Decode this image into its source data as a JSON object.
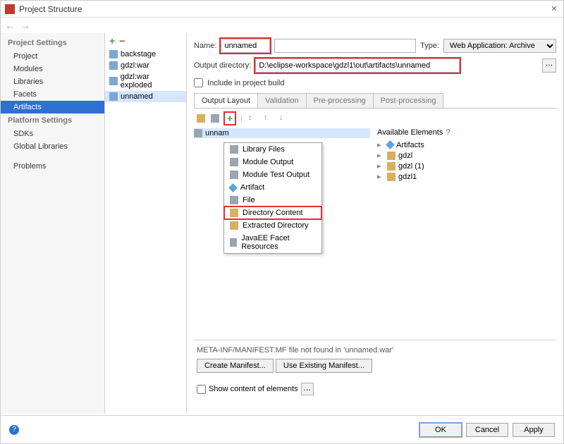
{
  "title": "Project Structure",
  "sidebar": {
    "sections": [
      {
        "label": "Project Settings",
        "items": [
          "Project",
          "Modules",
          "Libraries",
          "Facets",
          "Artifacts"
        ]
      },
      {
        "label": "Platform Settings",
        "items": [
          "SDKs",
          "Global Libraries"
        ]
      },
      {
        "label": "",
        "items": [
          "Problems"
        ]
      }
    ],
    "selected": "Artifacts"
  },
  "artlist": {
    "items": [
      "backstage",
      "gdzl:war",
      "gdzl:war exploded",
      "unnamed"
    ],
    "selected": "unnamed"
  },
  "form": {
    "name_label": "Name:",
    "name_value": "unnamed",
    "type_label": "Type:",
    "type_value": "Web Application: Archive",
    "outdir_label": "Output directory:",
    "outdir_value": "D:\\eclipse-workspace\\gdzl1\\out\\artifacts\\unnamed",
    "include_label": "Include in project build"
  },
  "tabs": [
    "Output Layout",
    "Validation",
    "Pre-processing",
    "Post-processing"
  ],
  "active_tab": "Output Layout",
  "tree_root": "unnam",
  "popup": {
    "items": [
      "Library Files",
      "Module Output",
      "Module Test Output",
      "Artifact",
      "File",
      "Directory Content",
      "Extracted Directory",
      "JavaEE Facet Resources"
    ],
    "highlighted": "Directory Content"
  },
  "available": {
    "label": "Available Elements",
    "items": [
      {
        "label": "Artifacts",
        "icon": "diamond"
      },
      {
        "label": "gdzl",
        "icon": "folder"
      },
      {
        "label": "gdzl (1)",
        "icon": "folder"
      },
      {
        "label": "gdzl1",
        "icon": "folder"
      }
    ]
  },
  "manifest": {
    "msg": "META-INF/MANIFEST.MF file not found in 'unnamed.war'",
    "create": "Create Manifest...",
    "use": "Use Existing Manifest..."
  },
  "show_content": "Show content of elements",
  "footer": {
    "ok": "OK",
    "cancel": "Cancel",
    "apply": "Apply"
  }
}
